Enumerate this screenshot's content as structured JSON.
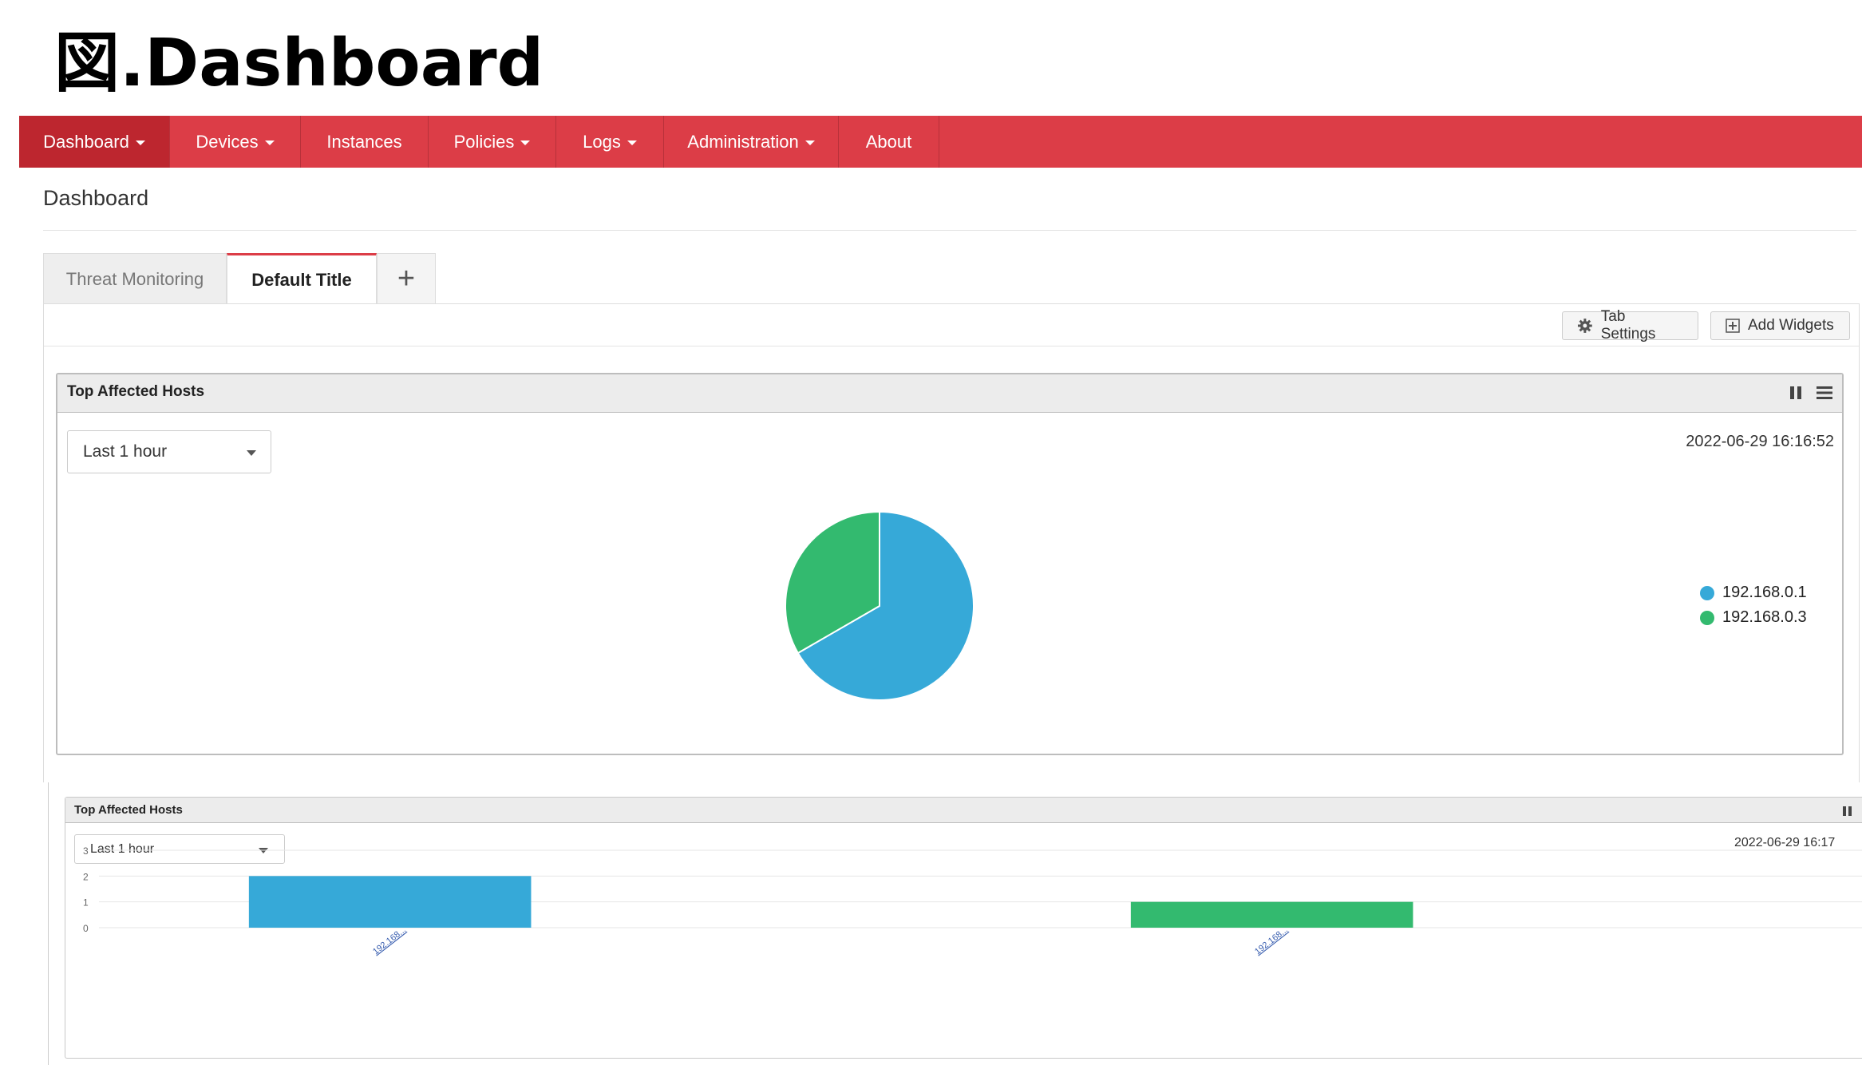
{
  "doc_title": "図.Dashboard",
  "navbar": {
    "items": [
      {
        "label": "Dashboard",
        "dropdown": true,
        "active": true
      },
      {
        "label": "Devices",
        "dropdown": true
      },
      {
        "label": "Instances",
        "dropdown": false
      },
      {
        "label": "Policies",
        "dropdown": true
      },
      {
        "label": "Logs",
        "dropdown": true
      },
      {
        "label": "Administration",
        "dropdown": true
      },
      {
        "label": "About",
        "dropdown": false
      }
    ]
  },
  "page_title": "Dashboard",
  "tabs": [
    {
      "label": "Threat Monitoring",
      "active": false
    },
    {
      "label": "Default Title",
      "active": true
    },
    {
      "label": "+",
      "active": false
    }
  ],
  "toolbar": {
    "tab_settings": "Tab Settings",
    "add_widgets": "Add Widgets"
  },
  "widget_pie": {
    "title": "Top Affected Hosts",
    "range": "Last 1 hour",
    "timestamp": "2022-06-29 16:16:52",
    "legend": [
      "192.168.0.1",
      "192.168.0.3"
    ]
  },
  "widget_bar": {
    "title": "Top Affected Hosts",
    "range": "Last 1 hour",
    "timestamp": "2022-06-29 16:17"
  },
  "colors": {
    "nav_bg": "#dc3d47",
    "nav_active": "#bd262f",
    "series_blue": "#36a9d8",
    "series_green": "#33ba6f"
  },
  "chart_data": [
    {
      "type": "pie",
      "labels": [
        "192.168.0.1",
        "192.168.0.3"
      ],
      "values": [
        2,
        1
      ],
      "colors": [
        "#36a9d8",
        "#33ba6f"
      ],
      "legend": "right"
    },
    {
      "type": "bar",
      "categories": [
        "192.168...",
        "192.168..."
      ],
      "series": [
        {
          "values": [
            2,
            1
          ]
        }
      ],
      "colors": [
        "#36a9d8",
        "#33ba6f"
      ],
      "yticks": [
        0,
        1,
        2,
        3
      ],
      "ylim": [
        0,
        3
      ],
      "grid": true
    }
  ]
}
